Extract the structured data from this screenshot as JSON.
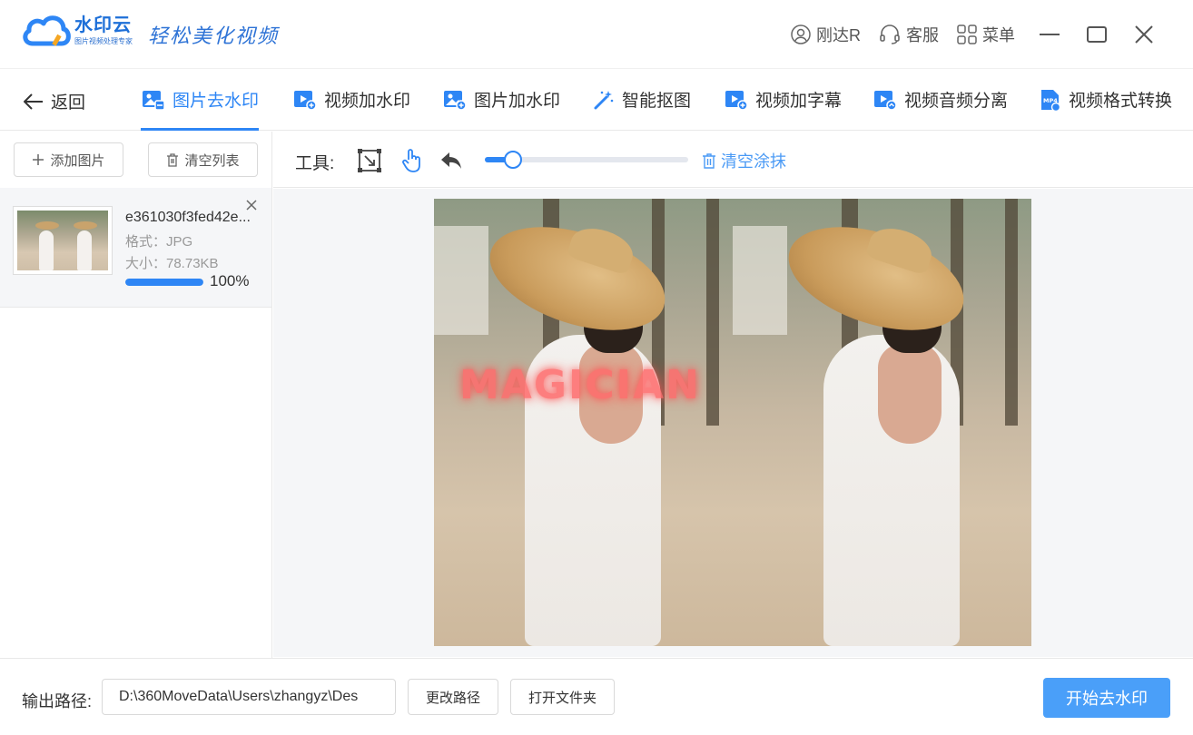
{
  "app": {
    "name": "水印云",
    "subtitle": "图片视频处理专家",
    "slogan": "轻松美化视频",
    "brand_color": "#2e86f5"
  },
  "header": {
    "user": "刚达R",
    "support": "客服",
    "menu": "菜单"
  },
  "nav": {
    "back": "返回",
    "tabs": [
      {
        "label": "图片去水印",
        "icon": "image-icon",
        "active": true
      },
      {
        "label": "视频加水印",
        "icon": "video-icon",
        "active": false
      },
      {
        "label": "图片加水印",
        "icon": "image-add-icon",
        "active": false
      },
      {
        "label": "智能抠图",
        "icon": "magic-wand-icon",
        "active": false
      },
      {
        "label": "视频加字幕",
        "icon": "video-subtitle-icon",
        "active": false
      },
      {
        "label": "视频音频分离",
        "icon": "video-audio-icon",
        "active": false
      },
      {
        "label": "视频格式转换",
        "icon": "mp4-icon",
        "active": false
      }
    ]
  },
  "sidebar": {
    "add_button": "添加图片",
    "clear_button": "清空列表",
    "file": {
      "name": "e361030f3fed42e...",
      "format": "格式：JPG",
      "size": "大小：78.73KB",
      "progress": 1.0,
      "progress_label": "100%"
    }
  },
  "toolbar": {
    "label": "工具:",
    "brush_size": 0.12,
    "clear_paint": "清空涂抹"
  },
  "canvas": {
    "watermark_text": "MAGICIAN"
  },
  "footer": {
    "output_label": "输出路径:",
    "output_path": "D:\\360MoveData\\Users\\zhangyz\\Des",
    "change_path": "更改路径",
    "open_folder": "打开文件夹",
    "start": "开始去水印"
  }
}
